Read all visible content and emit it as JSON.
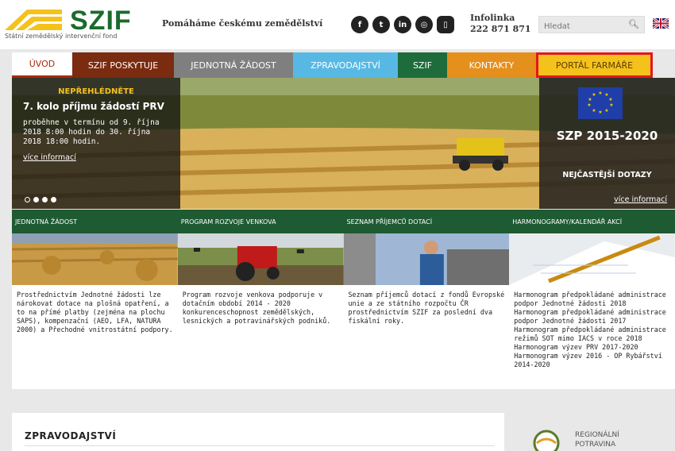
{
  "header": {
    "logo_text": "SZIF",
    "logo_subtitle": "Státní zemědělský intervenční fond",
    "tagline": "Pomáháme českému zemědělství",
    "social": [
      {
        "icon": "facebook-icon",
        "glyph": "f"
      },
      {
        "icon": "twitter-icon",
        "glyph": "t"
      },
      {
        "icon": "linkedin-icon",
        "glyph": "in"
      },
      {
        "icon": "instagram-icon",
        "glyph": "◎"
      },
      {
        "icon": "mobile-icon",
        "glyph": "▯"
      }
    ],
    "infolinka_label": "Infolinka",
    "infolinka_number": "222 871 871",
    "search_placeholder": "Hledat"
  },
  "nav": {
    "items": [
      "ÚVOD",
      "SZIF POSKYTUJE",
      "JEDNOTNÁ ŽÁDOST",
      "ZPRAVODAJSTVÍ",
      "SZIF",
      "KONTAKTY",
      "PORTÁL FARMÁŘE"
    ]
  },
  "hero": {
    "kicker": "NEPŘEHLÉDNĚTE",
    "title": "7. kolo příjmu žádostí PRV",
    "text": "proběhne v termínu od 9. října 2018 8:00 hodin do 30. října 2018 18:00 hodin.",
    "more": "více informací",
    "right_title": "SZP 2015-2020",
    "right_sub": "NEJČASTĚJŠÍ DOTAZY",
    "right_more": "více informací"
  },
  "categories": [
    "JEDNOTNÁ ŽÁDOST",
    "PROGRAM ROZVOJE VENKOVA",
    "SEZNAM PŘÍJEMCŮ DOTACÍ",
    "HARMONOGRAMY/KALENDÁŘ AKCÍ"
  ],
  "cards": [
    "Prostřednictvím Jednotné žádosti lze nárokovat dotace na plošná opatření, a to na přímé platby (zejména na plochu SAPS), kompenzační (AEO, LFA, NATURA 2000) a Přechodné vnitrostátní podpory.",
    "Program rozvoje venkova podporuje v dotačním období 2014 - 2020 konkurenceschopnost zemědělských, lesnických a potravinářských podniků.",
    "Seznam příjemců dotací z fondů Evropské unie a ze státního rozpočtu ČR prostřednictvím SZIF za poslední dva fiskální roky.",
    "Harmonogram předpokládané administrace podpor Jednotné žádosti 2018 Harmonogram předpokládané administrace podpor Jednotné žádosti 2017 Harmonogram předpokládané administrace režimů SOT mimo IACS v roce 2018 Harmonogram výzev PRV 2017-2020 Harmonogram výzev 2016 - OP Rybářství 2014-2020"
  ],
  "news": {
    "title": "ZPRAVODAJSTVÍ"
  },
  "side": {
    "regional": "REGIONÁLNÍ POTRAVINA"
  },
  "colors": {
    "brand_green": "#1e5a32",
    "logo_yellow": "#f4c21b",
    "nav_highlight": "#e2171d"
  }
}
